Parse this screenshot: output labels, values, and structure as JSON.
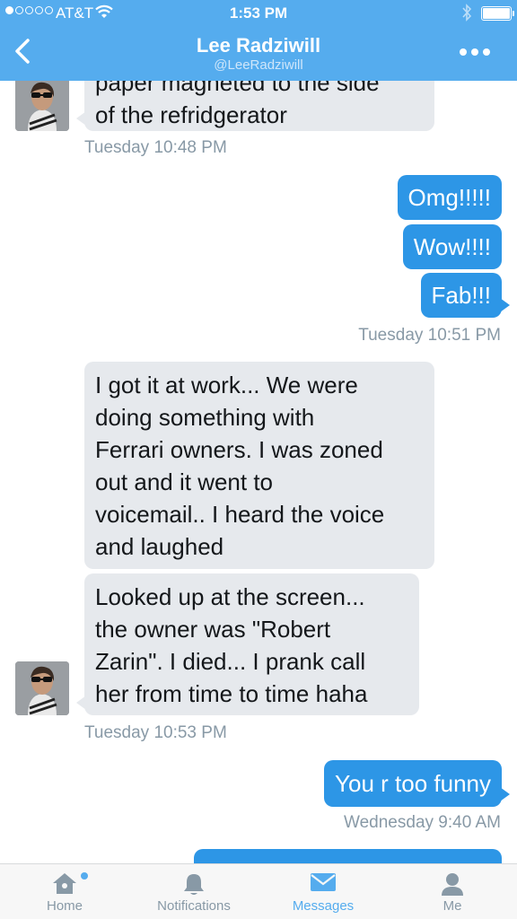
{
  "status_bar": {
    "carrier": "AT&T",
    "time": "1:53 PM"
  },
  "header": {
    "name": "Lee Radziwill",
    "handle": "@LeeRadziwill"
  },
  "messages": [
    {
      "direction": "in",
      "lines": [
        "paper magneted to the side",
        "of the refridgerator"
      ]
    },
    {
      "timestamp": "Tuesday 10:48 PM"
    },
    {
      "direction": "out",
      "text": "Omg!!!!!"
    },
    {
      "direction": "out",
      "text": "Wow!!!!"
    },
    {
      "direction": "out",
      "text": "Fab!!!"
    },
    {
      "timestamp": "Tuesday 10:51 PM"
    },
    {
      "direction": "in",
      "lines": [
        "I got it at work... We were",
        "doing something with",
        "Ferrari owners. I was zoned",
        "out and it went to",
        "voicemail.. I heard the voice",
        "and laughed"
      ]
    },
    {
      "direction": "in",
      "lines": [
        "Looked up at the screen...",
        "the owner was \"Robert",
        "Zarin\". I died... I prank call",
        "her from time to time haha"
      ]
    },
    {
      "timestamp": "Tuesday 10:53 PM"
    },
    {
      "direction": "out",
      "text": "You r too funny"
    },
    {
      "timestamp": "Wednesday 9:40 AM"
    }
  ],
  "tabs": [
    {
      "label": "Home",
      "icon": "home-icon",
      "active": false
    },
    {
      "label": "Notifications",
      "icon": "bell-icon",
      "active": false
    },
    {
      "label": "Messages",
      "icon": "envelope-icon",
      "active": true
    },
    {
      "label": "Me",
      "icon": "person-icon",
      "active": false
    }
  ],
  "colors": {
    "nav_blue": "#55acee",
    "outgoing_bubble": "#2d96e6",
    "incoming_bubble": "#e6e9ed",
    "timestamp_gray": "#8899a6"
  }
}
